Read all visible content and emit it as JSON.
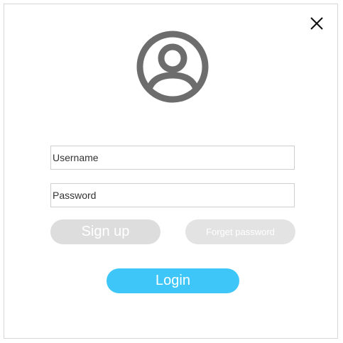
{
  "dialog": {
    "close_icon": "close-icon",
    "avatar_icon": "user-circle-icon"
  },
  "form": {
    "username_placeholder": "Username",
    "password_placeholder": "Password"
  },
  "buttons": {
    "signup_label": "Sign up",
    "forget_label": "Forget password",
    "login_label": "Login"
  },
  "colors": {
    "login_button": "#3fc6f8",
    "secondary_button": "#dddddd",
    "avatar": "#6d6d6d",
    "field_border": "#cfcfcf"
  }
}
